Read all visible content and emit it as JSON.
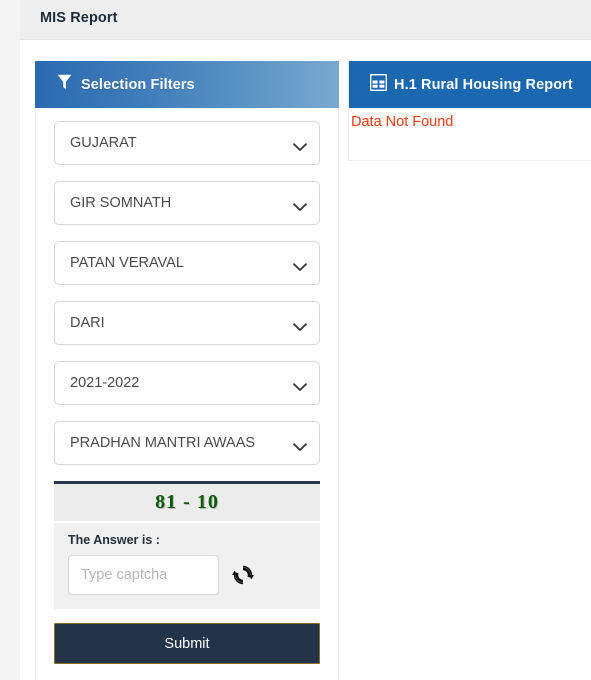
{
  "topbar": {
    "title": "MIS Report"
  },
  "filters": {
    "header_title": "Selection Filters",
    "header_icon": "funnel-icon",
    "selects": [
      {
        "name": "state",
        "value": "GUJARAT"
      },
      {
        "name": "district",
        "value": "GIR SOMNATH"
      },
      {
        "name": "block",
        "value": "PATAN VERAVAL"
      },
      {
        "name": "panchayat",
        "value": "DARI"
      },
      {
        "name": "financial-year",
        "value": "2021-2022"
      },
      {
        "name": "scheme",
        "value": "PRADHAN MANTRI AWAAS"
      }
    ],
    "captcha": {
      "challenge": "81 - 10",
      "label": "The Answer is :",
      "placeholder": "Type captcha",
      "value": "",
      "refresh_icon": "refresh-icon"
    },
    "submit_label": "Submit"
  },
  "report": {
    "header_icon": "table-grid-icon",
    "header_title": "H.1 Rural Housing Report",
    "message": "Data Not Found"
  },
  "colors": {
    "filters_header_from": "#2a6ab0",
    "filters_header_to": "#7aa9cf",
    "report_header": "#1b67b0",
    "submit_bg": "#23344a",
    "submit_border": "#8a6d1e",
    "captcha_text": "#0a5c0a",
    "error_text": "#f23a12",
    "topbar_bg": "#eeeeee"
  }
}
